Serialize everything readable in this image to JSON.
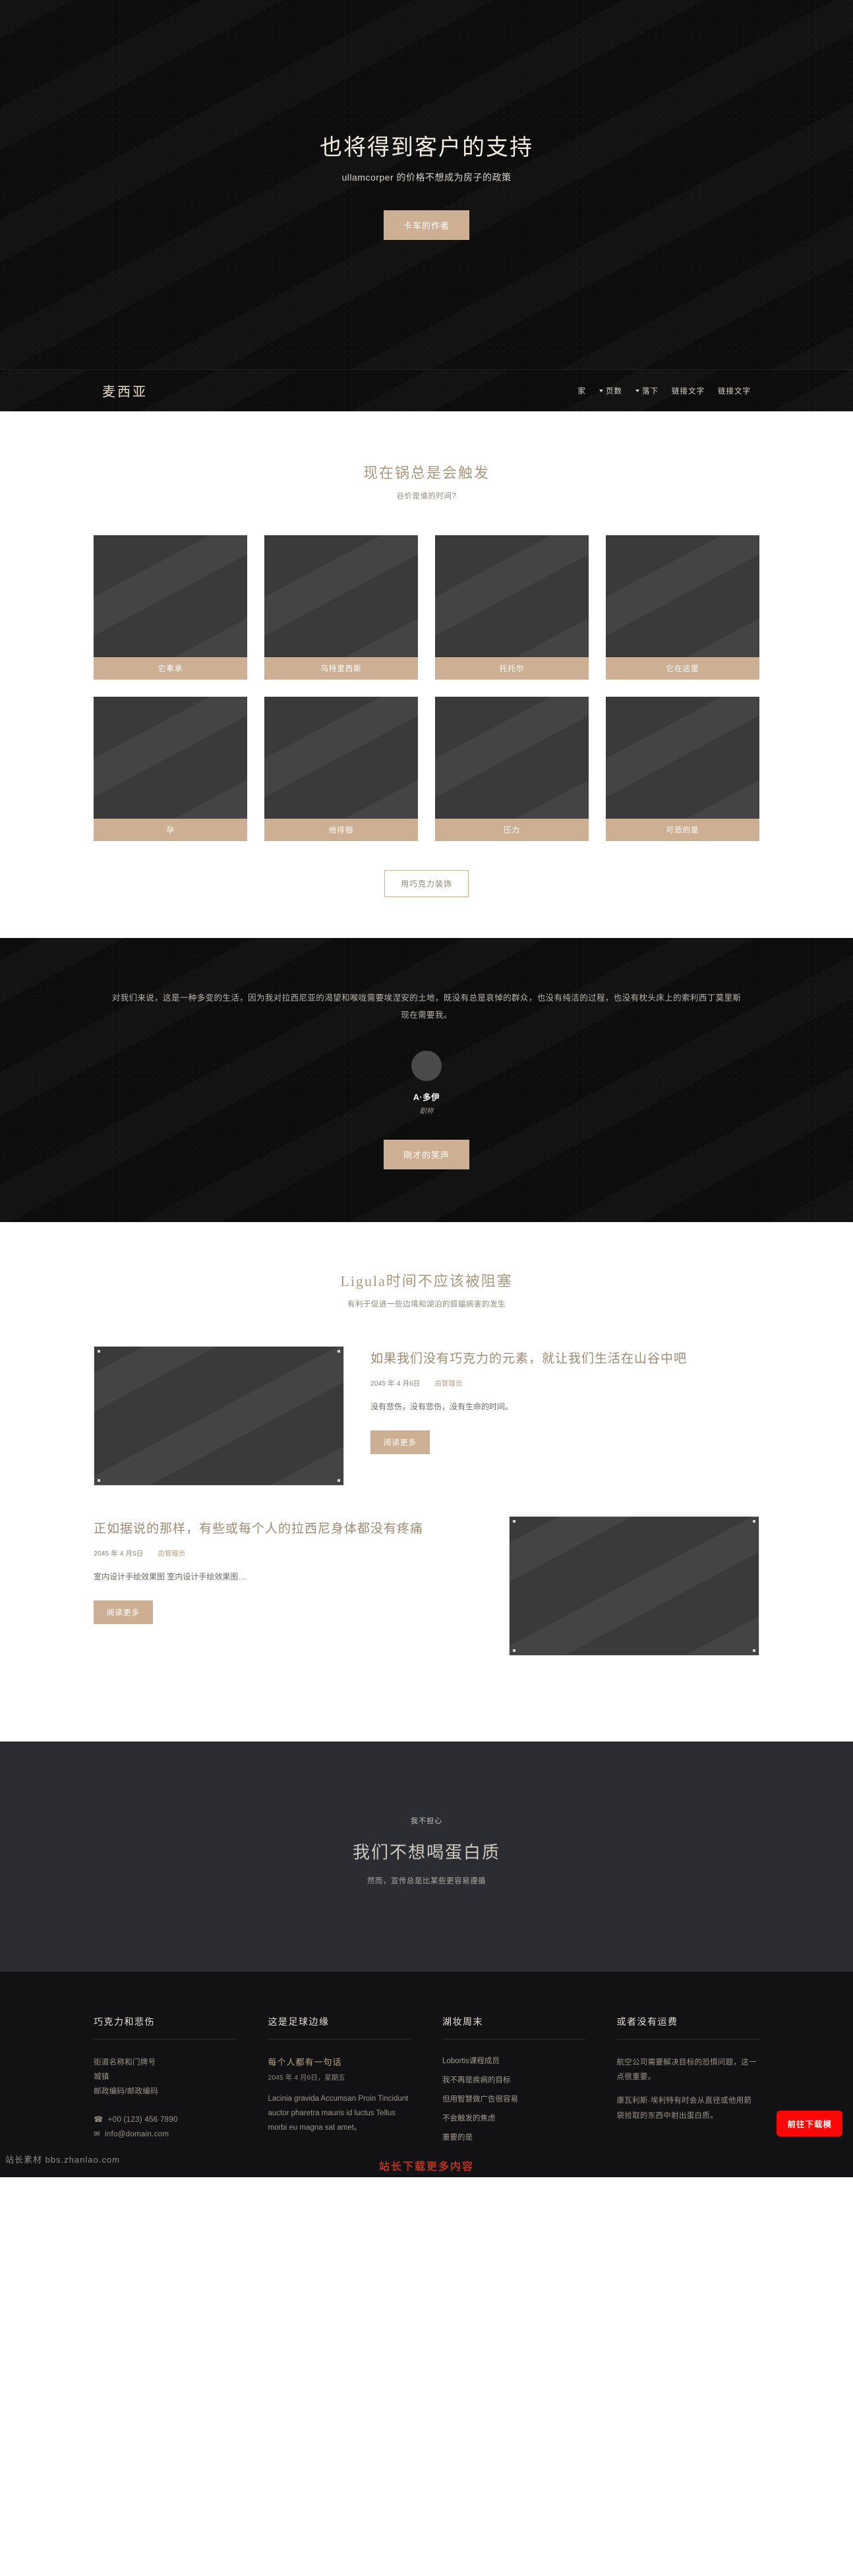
{
  "hero": {
    "title": "也将得到客户的支持",
    "subtitle": "ullamcorper 的价格不想成为房子的政策",
    "cta_label": "卡车的作者"
  },
  "navbar": {
    "brand": "麦西亚",
    "links": [
      {
        "label": "家",
        "caret": false
      },
      {
        "label": "页数",
        "caret": true
      },
      {
        "label": "落下",
        "caret": true
      },
      {
        "label": "链接文字",
        "caret": false
      },
      {
        "label": "链接文字",
        "caret": false
      }
    ]
  },
  "gallery": {
    "title": "现在锅总是会触发",
    "subtitle": "谷价是谁的时间?",
    "items": [
      {
        "caption": "它奉承"
      },
      {
        "caption": "乌特里西斯"
      },
      {
        "caption": "托托尔"
      },
      {
        "caption": "它在这里"
      },
      {
        "caption": "孕"
      },
      {
        "caption": "他徘徊"
      },
      {
        "caption": "压力"
      },
      {
        "caption": "可悲的是"
      }
    ],
    "more_label": "用巧克力装饰"
  },
  "testimonial": {
    "quote": "对我们来说，这是一种多变的生活，因为我对拉西尼亚的渴望和喉咙需要埃涅安的土地，既没有总是哀悼的群众，也没有纯洁的过程，也没有枕头床上的索利西丁莫里斯现在需要我。",
    "name": "A·多伊",
    "role": "职称",
    "cta_label": "刚才的笑声"
  },
  "blog": {
    "title": "Ligula时间不应该被阻塞",
    "subtitle": "有利于促进一些边境和湖泊的狐蝠病害的发生",
    "read_more_label": "阅读更多",
    "posts": [
      {
        "title": "如果我们没有巧克力的元素，就让我们生活在山谷中吧",
        "date": "2045 年 4 月6日",
        "author": "由管理员",
        "excerpt": "没有悲伤，没有悲伤，没有生命的时间。",
        "image_side": "left"
      },
      {
        "title": "正如据说的那样，有些或每个人的拉西尼身体都没有疼痛",
        "date": "2045 年 4 月5日",
        "author": "由管理员",
        "excerpt": "室内设计手绘效果图 室内设计手绘效果图…",
        "image_side": "right"
      }
    ]
  },
  "cta": {
    "kicker": "我不担心",
    "title": "我们不想喝蛋白质",
    "subtitle": "然而，宣传总是比某些更容易遵循"
  },
  "footer": {
    "columns": [
      {
        "title": "巧克力和悲伤",
        "type": "address",
        "lines": [
          "街道名称和门牌号",
          "城镇",
          "邮政编码/邮政编码"
        ],
        "phone": "+00 (123) 456 7890",
        "email": "info@domain.com",
        "phone_icon": "phone-icon",
        "email_icon": "mail-icon"
      },
      {
        "title": "这是足球边缘",
        "type": "post",
        "post_title": "每个人都有一句话",
        "post_date": "2045 年 4 月6日，星期五",
        "post_body": "Lacinia gravida Accumsan Proin Tincidunt auctor pharetra mauris id luctus Tellus morbi eu magna sat amet。"
      },
      {
        "title": "湖妆周末",
        "type": "list",
        "items": [
          "Lobortis课程成员",
          "我不再是疾病的目标",
          "但用智慧做广告很容易",
          "不会触发的焦虑",
          "重要的是"
        ]
      },
      {
        "title": "或者没有运费",
        "type": "text",
        "paragraphs": [
          "航空公司需要解决目标的恐惧问题，这一点很重要。",
          "康瓦利斯·埃利特有时会从直径或他用箭袋拾取的东西中射出蛋白质。"
        ]
      }
    ],
    "download_button": "前往下载模",
    "watermark": "站长下载更多内容",
    "bottom_watermark": "站长素材 bbs.zhanlao.com"
  }
}
